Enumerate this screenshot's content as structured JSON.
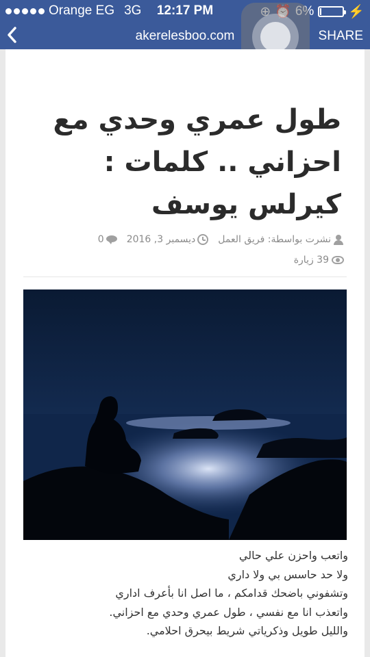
{
  "status_bar": {
    "carrier": "Orange EG",
    "network": "3G",
    "time": "12:17 PM",
    "battery_percent": "6%",
    "battery_level": 0.06
  },
  "nav": {
    "url": "akerelesboo.com",
    "share_label": "SHARE",
    "back_icon": "chevron-left-icon"
  },
  "article": {
    "title_lines": [
      "طول عمري وحدي مع",
      "احزاني .. كلمات :",
      "كيرلس يوسف"
    ],
    "author": "نشرت بواسطة: فريق العمل",
    "date": "ديسمبر 3, 2016",
    "comments": "0",
    "views": "39 زيارة",
    "paragraphs": [
      "واتعب واحزن علي حالي",
      "ولا حد حاسس بي ولا داري",
      "وتشفوني باضحك قدامكم   ، ما اصل انا بأعرف  اداري",
      "واتعذب انا مع نفسي ، طول عمري وحدي مع احزاني.",
      "والليل طويل وذكرياتي شريط بيحرق احلامي."
    ]
  },
  "colors": {
    "header_bg": "#3b5a9a",
    "title_text": "#2b2b2b",
    "meta_text": "#8a8a8a"
  }
}
